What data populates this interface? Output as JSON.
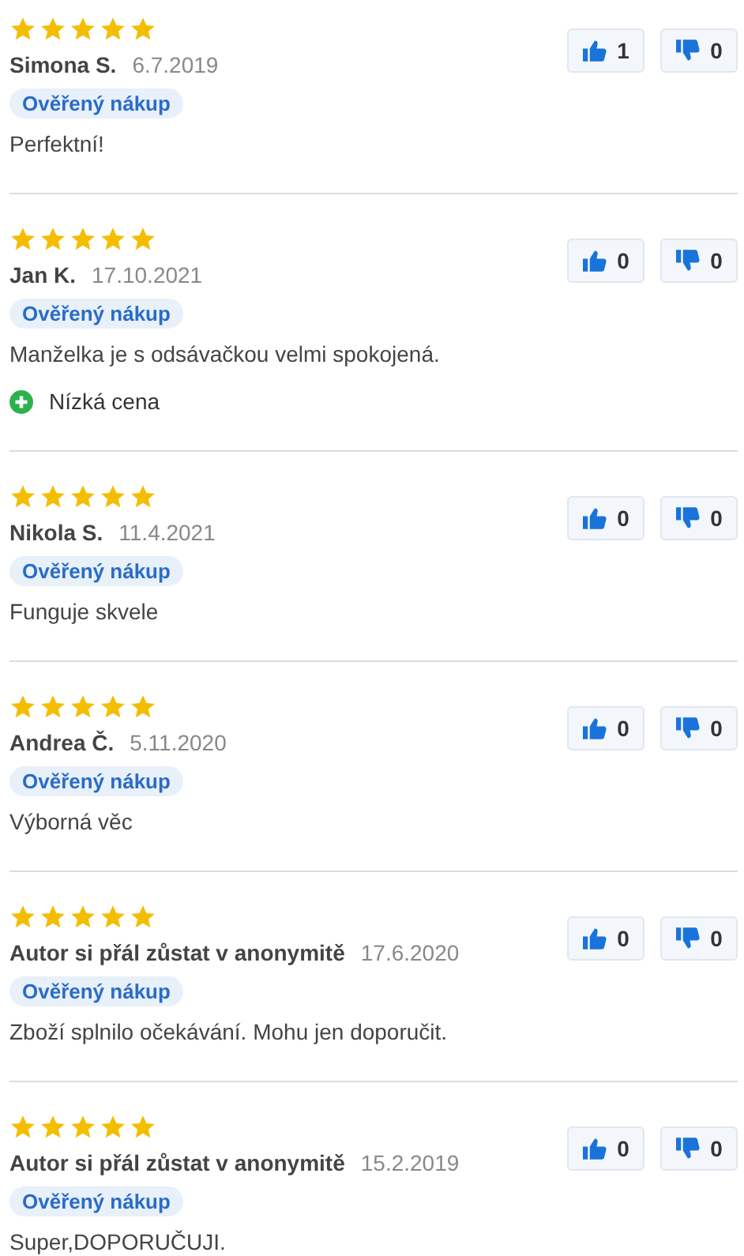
{
  "reviews": [
    {
      "stars": 5,
      "author": "Simona S.",
      "date": "6.7.2019",
      "badge": "Ověřený nákup",
      "text": "Perfektní!",
      "likes": "1",
      "dislikes": "0"
    },
    {
      "stars": 5,
      "author": "Jan K.",
      "date": "17.10.2021",
      "badge": "Ověřený nákup",
      "text": "Manželka je s odsávačkou velmi spokojená.",
      "pros": [
        "Nízká cena"
      ],
      "likes": "0",
      "dislikes": "0"
    },
    {
      "stars": 5,
      "author": "Nikola S.",
      "date": "11.4.2021",
      "badge": "Ověřený nákup",
      "text": "Funguje skvele",
      "likes": "0",
      "dislikes": "0"
    },
    {
      "stars": 5,
      "author": "Andrea Č.",
      "date": "5.11.2020",
      "badge": "Ověřený nákup",
      "text": "Výborná věc",
      "likes": "0",
      "dislikes": "0"
    },
    {
      "stars": 5,
      "author": "Autor si přál zůstat v anonymitě",
      "date": "17.6.2020",
      "badge": "Ověřený nákup",
      "text": "Zboží splnilo očekávání. Mohu jen doporučit.",
      "likes": "0",
      "dislikes": "0"
    },
    {
      "stars": 5,
      "author": "Autor si přál zůstat v anonymitě",
      "date": "15.2.2019",
      "badge": "Ověřený nákup",
      "text": "Super,DOPORUČUJI.",
      "likes": "0",
      "dislikes": "0"
    }
  ]
}
